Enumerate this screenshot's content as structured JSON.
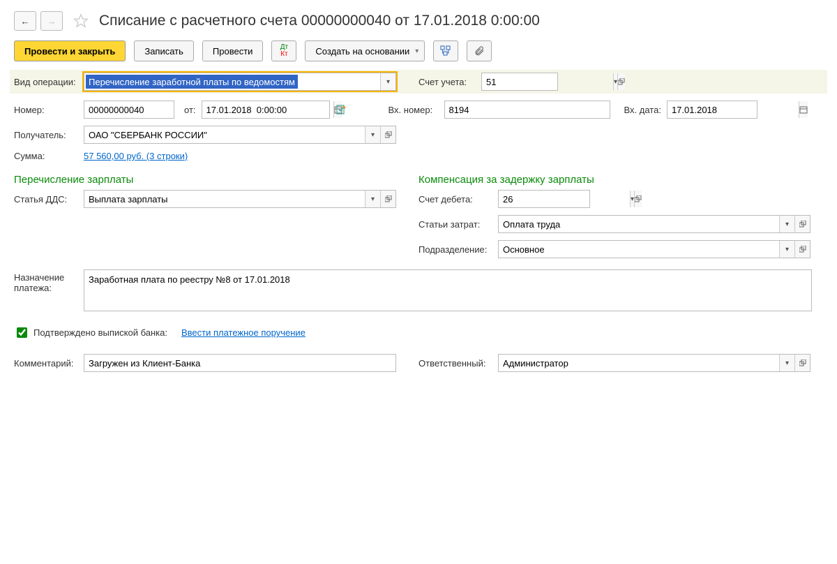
{
  "header": {
    "title": "Списание с расчетного счета 00000000040 от 17.01.2018 0:00:00"
  },
  "toolbar": {
    "post_close": "Провести и закрыть",
    "save": "Записать",
    "post": "Провести",
    "create_based": "Создать на основании"
  },
  "operation_type": {
    "label": "Вид операции:",
    "value": "Перечисление заработной платы по ведомостям"
  },
  "account": {
    "label": "Счет учета:",
    "value": "51"
  },
  "number": {
    "label": "Номер:",
    "value": "00000000040"
  },
  "date": {
    "label": "от:",
    "value": "17.01.2018  0:00:00"
  },
  "in_number": {
    "label": "Вх. номер:",
    "value": "8194"
  },
  "in_date": {
    "label": "Вх. дата:",
    "value": "17.01.2018"
  },
  "recipient": {
    "label": "Получатель:",
    "value": "ОАО \"СБЕРБАНК РОССИИ\""
  },
  "sum": {
    "label": "Сумма:",
    "value": "57 560,00 руб. (3 строки)"
  },
  "section_salary": "Перечисление зарплаты",
  "section_compensation": "Компенсация за задержку зарплаты",
  "dds": {
    "label": "Статья ДДС:",
    "value": "Выплата зарплаты"
  },
  "debit_account": {
    "label": "Счет дебета:",
    "value": "26"
  },
  "cost_items": {
    "label": "Статьи затрат:",
    "value": "Оплата труда"
  },
  "department": {
    "label": "Подразделение:",
    "value": "Основное"
  },
  "purpose": {
    "label": "Назначение платежа:",
    "value": "Заработная плата по реестру №8 от 17.01.2018"
  },
  "confirmed": {
    "label": "Подтверждено выпиской банка:",
    "link": "Ввести платежное поручение"
  },
  "comment": {
    "label": "Комментарий:",
    "value": "Загружен из Клиент-Банка"
  },
  "responsible": {
    "label": "Ответственный:",
    "value": "Администратор"
  }
}
